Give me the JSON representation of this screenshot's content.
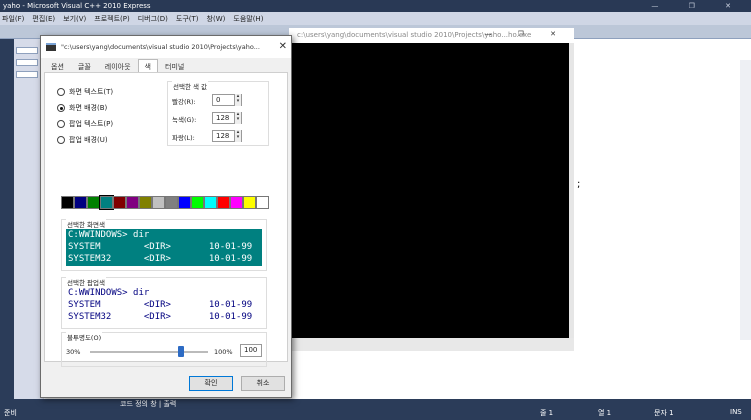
{
  "vs": {
    "title": "yaho - Microsoft Visual C++ 2010 Express",
    "menu": [
      "파일(F)",
      "편집(E)",
      "보기(V)",
      "프로젝트(P)",
      "디버그(D)",
      "도구(T)",
      "창(W)",
      "도움말(H)"
    ],
    "status": {
      "ready": "준비",
      "line": "줄 1",
      "col": "열 1",
      "ch": "문자 1",
      "ins": "INS",
      "tabs": "코드 정의 창 | 출력"
    }
  },
  "console": {
    "title": "c:\\users\\yang\\documents\\visual studio 2010\\Projects\\yaho...ho.exe",
    "semicolon": ";"
  },
  "dialog": {
    "title": "\"c:\\users\\yang\\documents\\visual studio 2010\\Projects\\yaho...",
    "tabs": [
      "옵션",
      "글꼴",
      "레이아웃",
      "색",
      "터미널"
    ],
    "radios": [
      "화면 텍스트(T)",
      "화면 배경(B)",
      "팝업 텍스트(P)",
      "팝업 배경(U)"
    ],
    "selected_radio": "화면 배경(B)",
    "rgb_group_title": "선택한 색 값",
    "rgb": [
      {
        "label": "빨강(R):",
        "value": "0"
      },
      {
        "label": "녹색(G):",
        "value": "128"
      },
      {
        "label": "파랑(L):",
        "value": "128"
      }
    ],
    "palette": [
      "#000000",
      "#000080",
      "#008000",
      "#008080",
      "#800000",
      "#800080",
      "#808000",
      "#c0c0c0",
      "#808080",
      "#0000ff",
      "#00ff00",
      "#00ffff",
      "#ff0000",
      "#ff00ff",
      "#ffff00",
      "#ffffff"
    ],
    "selected_color": "#008080",
    "screen_preview": {
      "caption": "선택한 화면색",
      "lines": [
        "C:WWINDOWS> dir",
        "SYSTEM        <DIR>       10-01-99",
        "SYSTEM32      <DIR>       10-01-99"
      ],
      "bg": "#008080",
      "fg": "#ffffff"
    },
    "popup_preview": {
      "caption": "선택한 팝업색",
      "lines": [
        "C:WWINDOWS> dir",
        "SYSTEM        <DIR>       10-01-99",
        "SYSTEM32      <DIR>       10-01-99"
      ],
      "bg": "#ffffff",
      "fg": "#000080"
    },
    "opacity": {
      "label": "불투명도(O)",
      "min": "30%",
      "max": "100%",
      "value": "100"
    },
    "ok": "확인",
    "cancel": "취소"
  }
}
